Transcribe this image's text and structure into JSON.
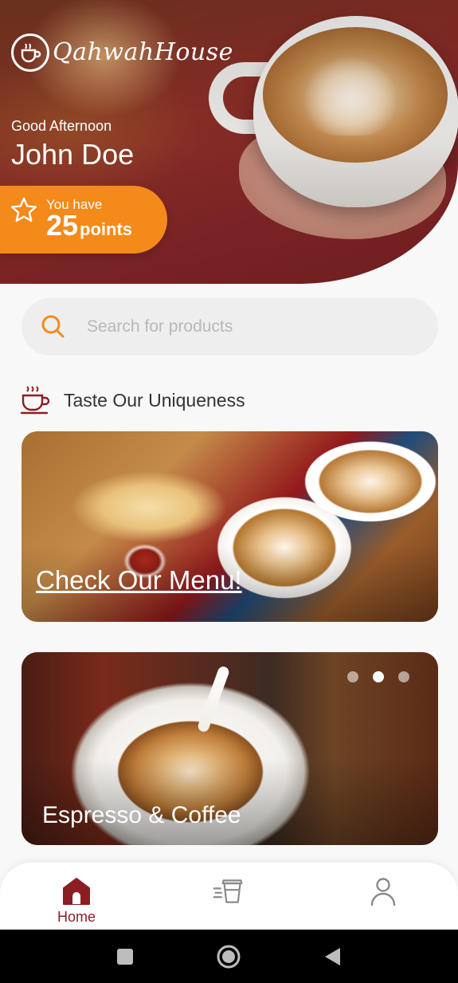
{
  "app": {
    "logo_text": "QahwahHouse"
  },
  "header": {
    "greeting": "Good Afternoon",
    "username": "John Doe",
    "points_label": "You have",
    "points_value": "25",
    "points_unit": "points"
  },
  "search": {
    "placeholder": "Search for products",
    "value": ""
  },
  "section": {
    "title": "Taste Our Uniqueness"
  },
  "cards": [
    {
      "caption": "Check Our Menu!"
    },
    {
      "caption": "Espresso & Coffee"
    }
  ],
  "carousel": {
    "dot_count": 3,
    "active_dot": 2
  },
  "bottom_nav": {
    "items": [
      {
        "label": "Home",
        "icon": "home-icon",
        "active": true
      },
      {
        "label": "",
        "icon": "menu-cup-icon",
        "active": false
      },
      {
        "label": "",
        "icon": "profile-icon",
        "active": false
      }
    ]
  },
  "colors": {
    "brand_red": "#8b1e23",
    "accent_orange": "#f48a1a",
    "icon_gray": "#8a8a8a"
  }
}
